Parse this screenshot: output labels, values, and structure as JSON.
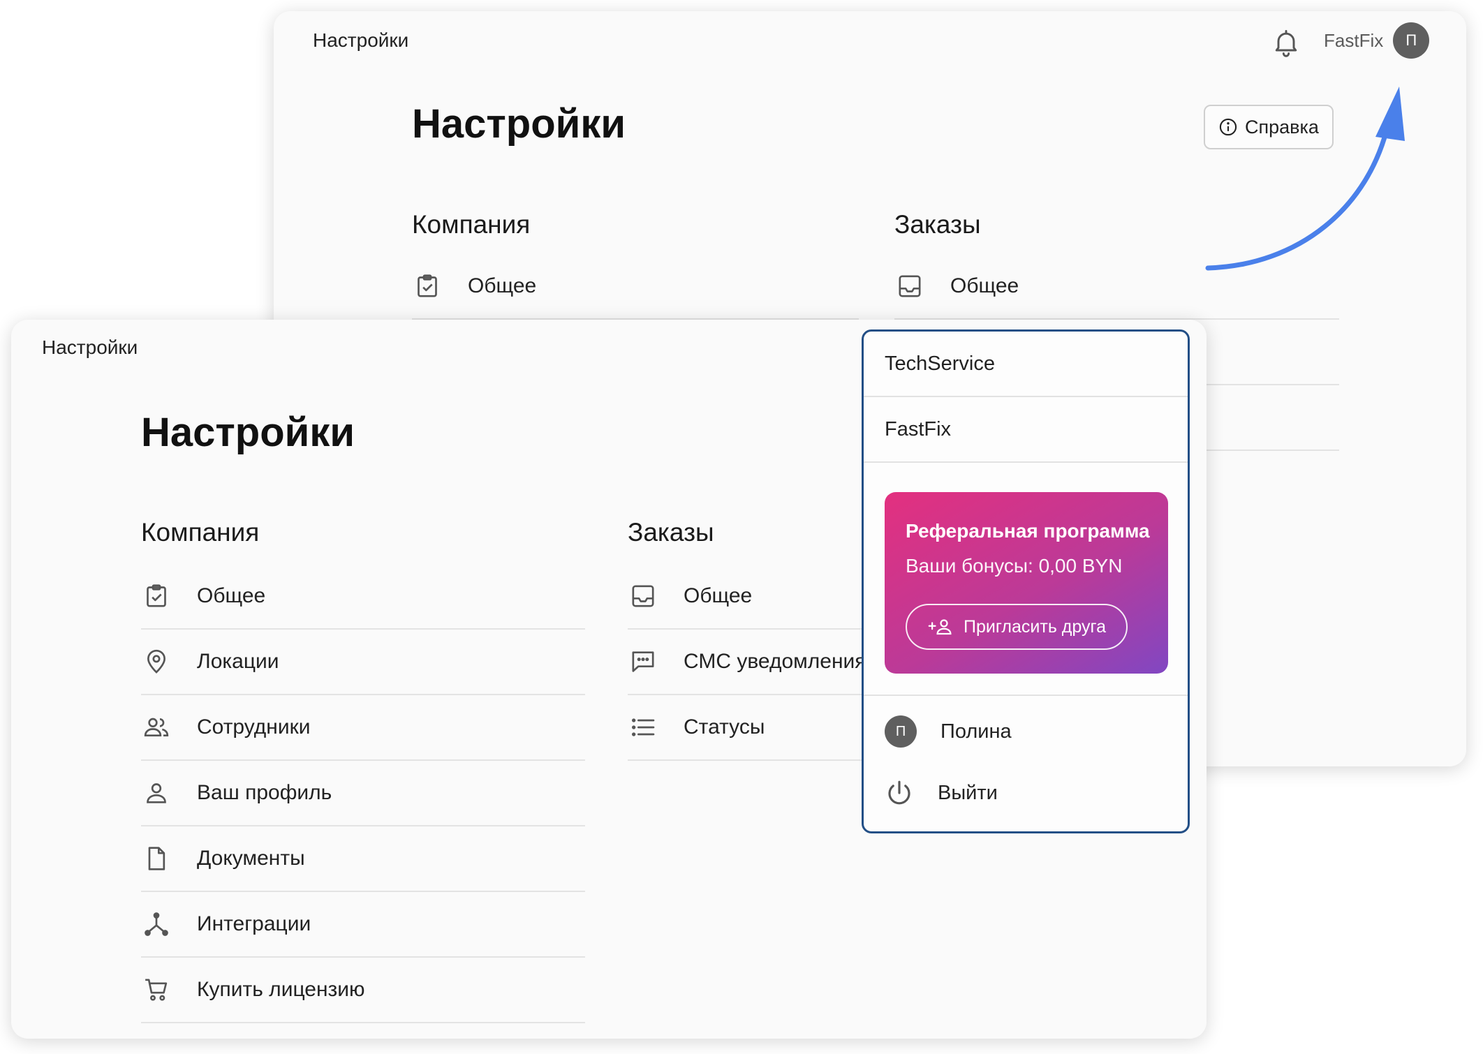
{
  "back_window": {
    "topbar_title": "Настройки",
    "company_name": "FastFix",
    "avatar_initial": "П",
    "page_title": "Настройки",
    "help_label": "Справка",
    "sections": {
      "company": {
        "title": "Компания",
        "items": [
          {
            "label": "Общее",
            "icon": "clipboard-check-icon"
          }
        ]
      },
      "orders": {
        "title": "Заказы",
        "items": [
          {
            "label": "Общее",
            "icon": "inbox-icon"
          }
        ]
      }
    }
  },
  "front_window": {
    "topbar_title": "Настройки",
    "page_title": "Настройки",
    "company_section": {
      "title": "Компания",
      "items": [
        {
          "label": "Общее",
          "icon": "clipboard-check-icon"
        },
        {
          "label": "Локации",
          "icon": "location-pin-icon"
        },
        {
          "label": "Сотрудники",
          "icon": "people-icon"
        },
        {
          "label": "Ваш профиль",
          "icon": "person-icon"
        },
        {
          "label": "Документы",
          "icon": "document-icon"
        },
        {
          "label": "Интеграции",
          "icon": "integration-icon"
        },
        {
          "label": "Купить лицензию",
          "icon": "cart-icon"
        }
      ]
    },
    "orders_section": {
      "title": "Заказы",
      "items": [
        {
          "label": "Общее",
          "icon": "inbox-icon"
        },
        {
          "label": "СМС уведомления",
          "icon": "chat-icon"
        },
        {
          "label": "Статусы",
          "icon": "list-icon"
        }
      ]
    }
  },
  "dropdown": {
    "companies": [
      "TechService",
      "FastFix"
    ],
    "referral": {
      "title": "Реферальная программа",
      "bonus": "Ваши бонусы: 0,00 BYN",
      "invite_label": "Пригласить друга"
    },
    "user": {
      "initial": "П",
      "name": "Полина"
    },
    "logout_label": "Выйти"
  },
  "colors": {
    "accent_arrow": "#4a80ea",
    "dropdown_border": "#234f86",
    "referral_gradient_start": "#e3307f",
    "referral_gradient_end": "#8147c2"
  }
}
